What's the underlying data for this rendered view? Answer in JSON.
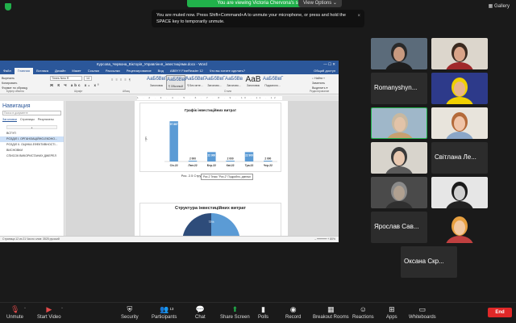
{
  "banner": {
    "text": "You are viewing Victoria Chervona's screen",
    "view_options": "View Options ⌄",
    "gallery_label": "▦ Gallery"
  },
  "mute_toast": {
    "text": "You are muted now. Press Shift+Command+A to unmute your microphone, or press and hold the SPACE key to temporarily unmute.",
    "close": "×"
  },
  "word": {
    "title": "Курсова_Червона_Вікторія_Управління_інвестиціями.docx - Word",
    "window_controls": "—  ☐  ✕",
    "tabs": [
      "Файл",
      "Главная",
      "Вставка",
      "Дизайн",
      "Макет",
      "Ссылки",
      "Рассылки",
      "Рецензирование",
      "Вид",
      "ABBYY FineReader 12",
      "Что вы хотите сделать?"
    ],
    "active_tab": "Главная",
    "share_label": "Общий доступ",
    "clipboard": [
      "Вырезать",
      "Копировать",
      "Формат по образцу"
    ],
    "clipboard_group": "Буфер обмена",
    "font_group": "Шрифт",
    "paragraph_group": "Абзац",
    "styles_group": "Стили",
    "editing_group": "Редактирование",
    "font_name": "Times New R",
    "font_size": "14",
    "format_buttons": "Ж К Ч  abc  x₂ x²",
    "paragraph_buttons": "≡ ≡ ≡ ≡  ¶",
    "styles": [
      {
        "sample": "АаБбВвГ",
        "name": "Заголовок"
      },
      {
        "sample": "АаБбВвГ",
        "name": "¶ Обычный"
      },
      {
        "sample": "АаБбВвГ",
        "name": "¶ Без инте..."
      },
      {
        "sample": "АаБбВвГ",
        "name": "Заголово..."
      },
      {
        "sample": "АаБбВв",
        "name": "Заголово..."
      },
      {
        "sample": "АаВ",
        "name": "Заголовок"
      },
      {
        "sample": "АаБбВвГ",
        "name": "Подзаголо..."
      }
    ],
    "editing": [
      "⌕ Найти ▾",
      "Заменить",
      "Выделить ▾"
    ],
    "ruler_ticks": "1 · 2 · 3 · 4 · 5 · 6 · 7 · 8 · 9 · 10 · 11 · 12 · 13 · 14 · 15 · 16 · 17",
    "nav": {
      "title": "Навигация",
      "search_placeholder": "Поиск в документе",
      "tabs": [
        "Заголовки",
        "Страницы",
        "Результаты"
      ],
      "items": [
        "ВСТУП",
        "РОЗДІЛ І. ОРГАНІЗАЦІЙНО-ЕКОНО...",
        "РОЗДІЛ ІІ. ОЦІНКА ЕФЕКТИВНОСТІ...",
        "ВИСНОВКИ",
        "СПИСОК ВИКОРИСТАНИХ ДЖЕРЕЛ"
      ],
      "selected_index": 1
    },
    "caption": "Рис. 2.5 Структура інвестиційних витрат",
    "pie_title": "Структура інвестиційних витрат",
    "context_tooltip": "Рис.2 Тезис \"Рис.2\" Подробно, данных",
    "statusbar": "Страница 12 из 21   Число слов: 3525   русский",
    "zoom": "– ━━━━━━ + 80%"
  },
  "chart_data": {
    "type": "bar",
    "title": "Графік інвестиційних витрат",
    "ylabel": "грн",
    "categories": [
      "Січ.22",
      "Лют.22",
      "Бер.22",
      "Кві.22",
      "Тра.22",
      "Чер.22"
    ],
    "values": [
      97867,
      2000,
      22900,
      2000,
      22900,
      2000
    ],
    "value_labels": [
      "97 867",
      "2 000",
      "22 900",
      "2 000",
      "22 900",
      "2 000"
    ],
    "ylim": [
      0,
      110000
    ],
    "color": "#5b9bd5"
  },
  "pie_data": {
    "type": "pie",
    "slice_label": "73%",
    "values": [
      73,
      27
    ],
    "colors": [
      "#5b9bd5",
      "#2e4c7a"
    ]
  },
  "participants": [
    {
      "kind": "video",
      "caption": ""
    },
    {
      "kind": "video",
      "caption": ""
    },
    {
      "kind": "name",
      "name": "Romanyshyn..."
    },
    {
      "kind": "video",
      "caption": ""
    },
    {
      "kind": "video",
      "caption": ""
    },
    {
      "kind": "video",
      "caption": ""
    },
    {
      "kind": "video",
      "caption": ""
    },
    {
      "kind": "name",
      "name": "Світлана Ле..."
    },
    {
      "kind": "video",
      "caption": ""
    },
    {
      "kind": "video",
      "caption": ""
    },
    {
      "kind": "name",
      "name": "Ярослав Сав..."
    },
    {
      "kind": "video",
      "caption": ""
    },
    {
      "kind": "name",
      "name": "Оксана Скр..."
    }
  ],
  "toolbar": {
    "unmute": "Unmute",
    "start_video": "Start Video",
    "security": "Security",
    "participants": "Participants",
    "participants_count": "13",
    "chat": "Chat",
    "share_screen": "Share Screen",
    "polls": "Polls",
    "record": "Record",
    "breakout_rooms": "Breakout Rooms",
    "reactions": "Reactions",
    "apps": "Apps",
    "whiteboards": "Whiteboards",
    "end": "End"
  }
}
